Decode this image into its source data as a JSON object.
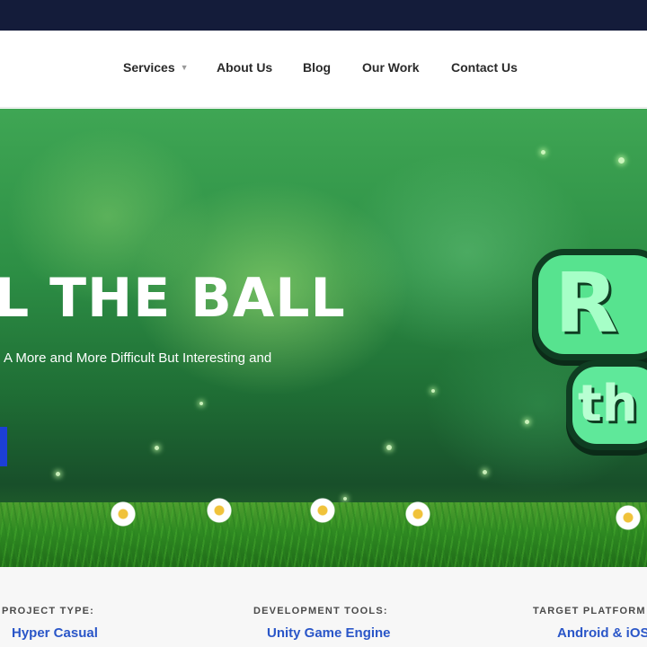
{
  "nav": {
    "items": [
      {
        "label": "Services",
        "has_dropdown": true
      },
      {
        "label": "About Us"
      },
      {
        "label": "Blog"
      },
      {
        "label": "Our Work"
      },
      {
        "label": "Contact Us"
      }
    ],
    "caret_glyph": "▼"
  },
  "hero": {
    "title": "L THE BALL",
    "subtitle": "A More and More Difficult But Interesting and",
    "logo_line1": "R",
    "logo_line2": "th"
  },
  "project": {
    "type_label": "PROJECT TYPE:",
    "type_value": "Hyper Casual",
    "tools_label": "DEVELOPMENT TOOLS:",
    "tools_value": "Unity Game Engine",
    "platform_label": "TARGET PLATFORM",
    "platform_value": "Android & iOS"
  },
  "colors": {
    "topbar": "#141c3a",
    "accent_blue": "#2a56c8",
    "button_blue": "#1c3fd6",
    "hero_green": "#2d8f45"
  }
}
